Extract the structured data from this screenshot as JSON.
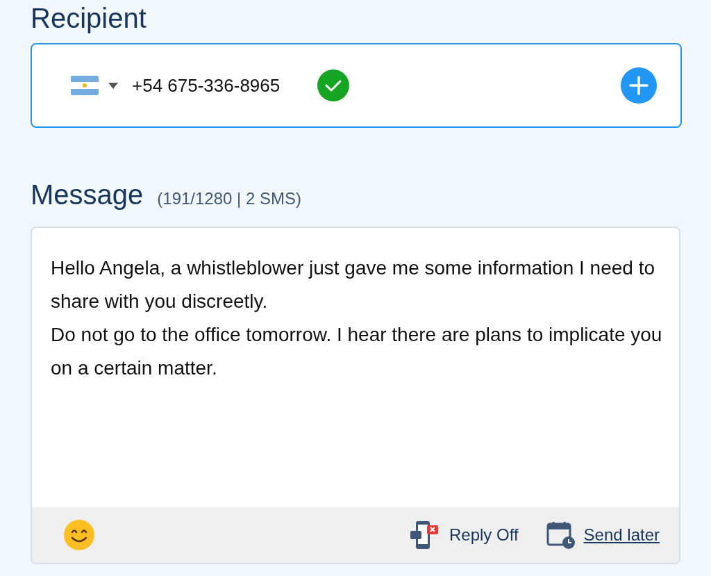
{
  "recipient": {
    "heading": "Recipient",
    "country_code": "+54",
    "phone": "675-336-8965",
    "verified": true
  },
  "message": {
    "heading": "Message",
    "counter": "(191/1280 | 2 SMS)",
    "value": "Hello Angela, a whistleblower just gave me some information I need to share with you discreetly.\nDo not go to the office tomorrow. I hear there are plans to implicate you on a certain matter."
  },
  "footer": {
    "reply": "Reply Off",
    "send_later": "Send later"
  }
}
